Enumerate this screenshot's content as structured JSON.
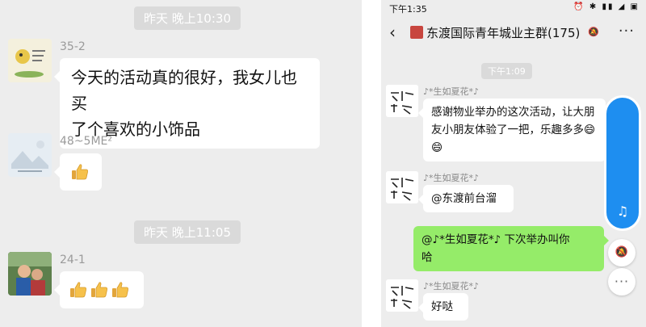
{
  "left": {
    "timestamps": [
      "昨天 晚上10:30",
      "昨天 晚上11:05"
    ],
    "messages": [
      {
        "sender": "35-2",
        "text_lines": [
          "今天的活动真的很好，我女儿也买",
          "了个喜欢的小饰品"
        ]
      },
      {
        "sender": "48~5ME²",
        "thumbs": 1
      },
      {
        "sender": "24-1",
        "thumbs": 3
      }
    ]
  },
  "right": {
    "status_time": "下午1:35",
    "status_icons": "⏰ ✱ ▮▮ ◢ ▣",
    "back_icon": "‹",
    "group_title": "东渡国际青年城业主群(175)",
    "more_icon": "···",
    "timestamp": "下午1:09",
    "messages": [
      {
        "sender": "♪*生如夏花*♪",
        "text_lines": [
          "感谢物业举办的这次活动，让大朋",
          "友小朋友体验了一把，乐趣多多😄",
          "😄"
        ]
      },
      {
        "sender": "♪*生如夏花*♪",
        "text": "@东渡前台溜"
      },
      {
        "text_lines": [
          "@♪*生如夏花*♪  下次举办叫你",
          "哈"
        ],
        "self": true
      },
      {
        "sender": "♪*生如夏花*♪",
        "text": "好哒"
      }
    ],
    "music_icon": "♫",
    "colors": {
      "accent": "#1e8ef0",
      "self_bubble": "#95ec69",
      "background": "#ededed"
    }
  }
}
